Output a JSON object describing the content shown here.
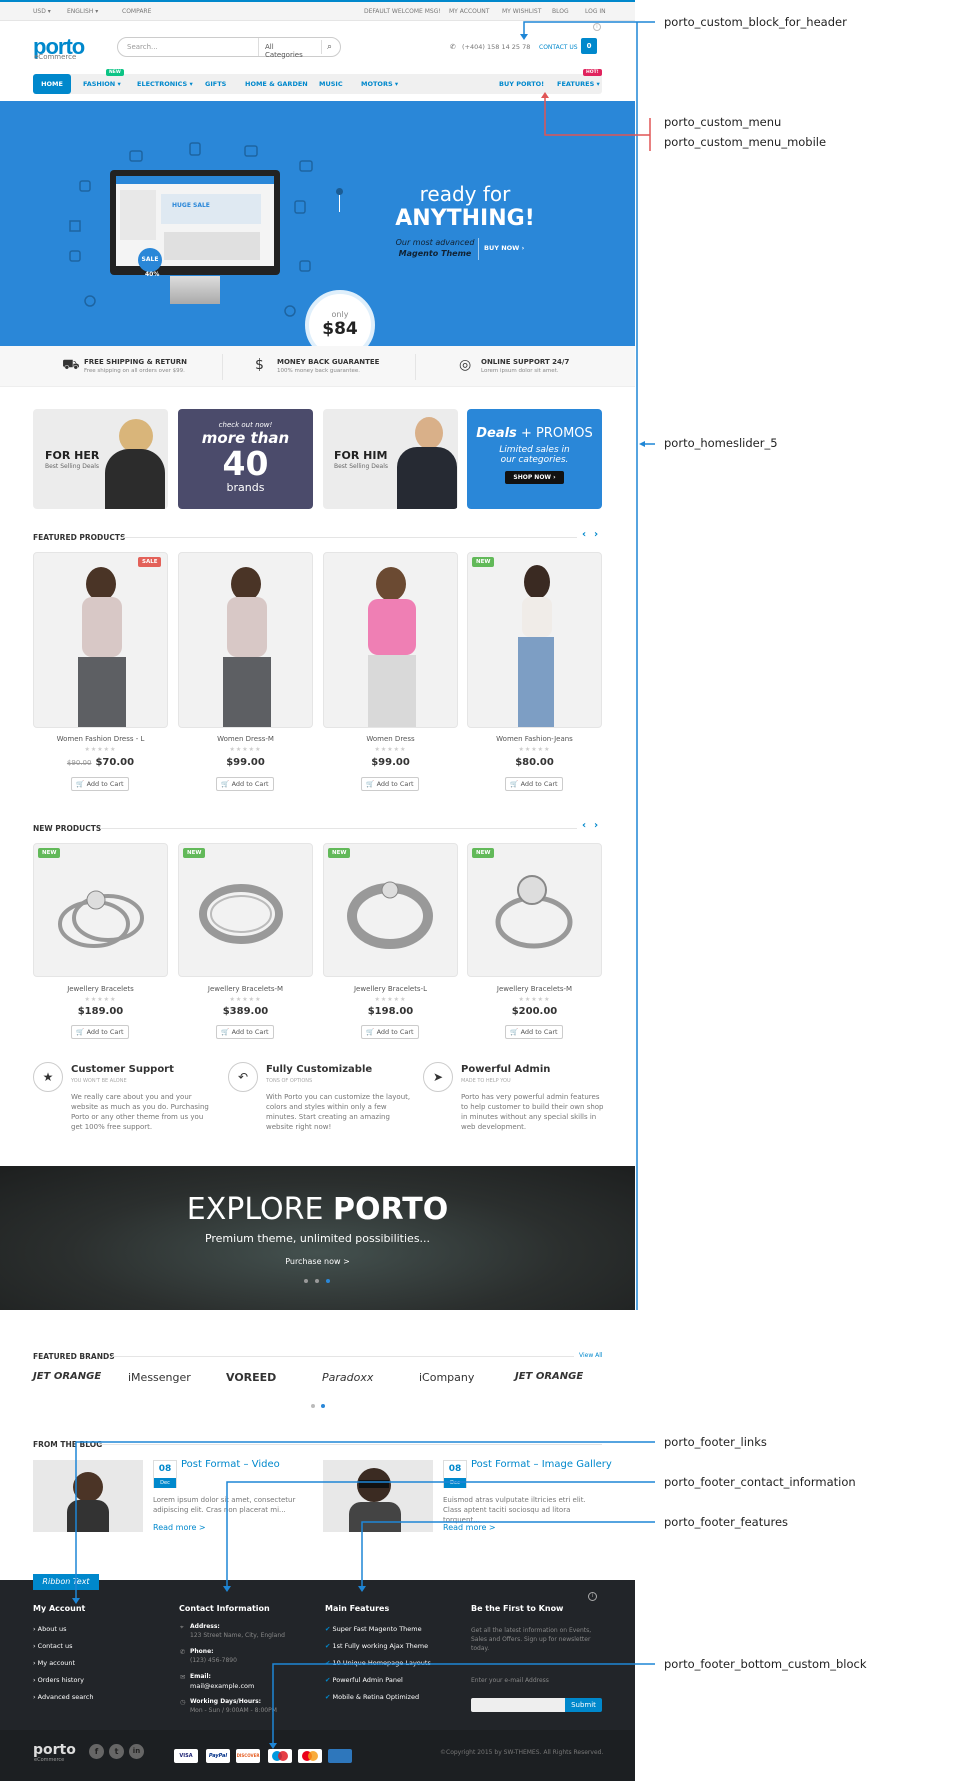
{
  "topbar": {
    "currency": "USD ▾",
    "language": "ENGLISH ▾",
    "compare": "COMPARE",
    "welcome": "DEFAULT WELCOME MSG!",
    "my_account": "MY ACCOUNT",
    "my_wishlist": "MY WISHLIST",
    "blog": "BLOG",
    "login": "LOG IN"
  },
  "header": {
    "logo": "porto",
    "logo_sub": "eCommerce",
    "search_placeholder": "Search...",
    "category": "All Categories",
    "phone": "(+404) 158 14 25 78",
    "contact": "CONTACT US",
    "cart_count": "0"
  },
  "nav": {
    "home": "HOME",
    "fashion": "FASHION ▾",
    "electronics": "ELECTRONICS ▾",
    "gifts": "GIFTS",
    "home_garden": "HOME & GARDEN",
    "music": "MUSIC",
    "motors": "MOTORS ▾",
    "buy": "BUY PORTO!",
    "features": "FEATURES ▾",
    "badge_new": "NEW",
    "badge_hot": "HOT!"
  },
  "hero": {
    "screen_text": "HUGE SALE",
    "sale": "SALE",
    "sale_pct": "40%",
    "only": "only",
    "price": "$84",
    "ready": "ready for",
    "anything": "ANYTHING!",
    "sub1": "Our most advanced",
    "sub2": "Magento Theme",
    "buy": "BUY NOW ›"
  },
  "features": [
    {
      "title": "FREE SHIPPING & RETURN",
      "desc": "Free shipping on all orders over $99.",
      "icon": "truck-icon"
    },
    {
      "title": "MONEY BACK GUARANTEE",
      "desc": "100% money back guarantee.",
      "icon": "dollar-icon"
    },
    {
      "title": "ONLINE SUPPORT 24/7",
      "desc": "Lorem ipsum dolor sit amet.",
      "icon": "lifebuoy-icon"
    }
  ],
  "banners": {
    "her": "FOR HER",
    "her_sub": "Best Selling Deals",
    "check": "check out now!",
    "more": "more than",
    "forty": "40",
    "brands": "brands",
    "him": "FOR HIM",
    "him_sub": "Best Selling Deals",
    "deals": "Deals",
    "promos": "+ PROMOS",
    "limited": "Limited sales in",
    "cats": "our categories.",
    "shop": "SHOP NOW ›"
  },
  "featured": {
    "title": "FEATURED PRODUCTS",
    "items": [
      {
        "name": "Women Fashion Dress - L",
        "old": "$90.00",
        "price": "$70.00",
        "badge": "SALE"
      },
      {
        "name": "Women Dress-M",
        "old": "",
        "price": "$99.00",
        "badge": ""
      },
      {
        "name": "Women Dress",
        "old": "",
        "price": "$99.00",
        "badge": ""
      },
      {
        "name": "Women Fashion-Jeans",
        "old": "",
        "price": "$80.00",
        "badge": "NEW"
      }
    ]
  },
  "newp": {
    "title": "NEW PRODUCTS",
    "items": [
      {
        "name": "Jewellery Bracelets",
        "price": "$189.00",
        "badge": "NEW"
      },
      {
        "name": "Jewellery Bracelets-M",
        "price": "$389.00",
        "badge": "NEW"
      },
      {
        "name": "Jewellery Bracelets-L",
        "price": "$198.00",
        "badge": "NEW"
      },
      {
        "name": "Jewellery Bracelets-M",
        "price": "$200.00",
        "badge": "NEW"
      }
    ]
  },
  "add_to_cart": "Add to Cart",
  "stars": "★★★★★",
  "services": [
    {
      "title": "Customer Support",
      "sub": "YOU WON'T BE ALONE",
      "desc": "We really care about you and your website as much as you do. Purchasing Porto or any other theme from us you get 100% free support.",
      "icon": "star-icon"
    },
    {
      "title": "Fully Customizable",
      "sub": "TONS OF OPTIONS",
      "desc": "With Porto you can customize the layout, colors and styles within only a few minutes. Start creating an amazing website right now!",
      "icon": "undo-icon"
    },
    {
      "title": "Powerful Admin",
      "sub": "MADE TO HELP YOU",
      "desc": "Porto has very powerful admin features to help customer to build their own shop in minutes without any special skills in web development.",
      "icon": "paper-plane-icon"
    }
  ],
  "explore": {
    "t1": "EXPLORE",
    "t2": "PORTO",
    "sub": "Premium theme, unlimited possibilities...",
    "link": "Purchase now >"
  },
  "brands": {
    "title": "FEATURED BRANDS",
    "view": "View All",
    "list": [
      "JET ORANGE",
      "iMessenger",
      "VOREED",
      "Paradoxx",
      "iCompany",
      "JET ORANGE"
    ]
  },
  "blog": {
    "title": "FROM THE BLOG",
    "posts": [
      {
        "day": "08",
        "month": "Dec",
        "title": "Post Format – Video",
        "desc": "Lorem ipsum dolor sit amet, consectetur adipiscing elit. Cras non placerat mi...",
        "more": "Read more >"
      },
      {
        "day": "08",
        "month": "Dec",
        "title": "Post Format – Image Gallery",
        "desc": "Euismod atras vulputate iltricies etri elit. Class aptent taciti sociosqu ad litora torquent...",
        "more": "Read more >"
      }
    ]
  },
  "footer": {
    "ribbon": "Ribbon Text",
    "account_title": "My Account",
    "account_links": [
      "About us",
      "Contact us",
      "My account",
      "Orders history",
      "Advanced search"
    ],
    "contact_title": "Contact Information",
    "address_l": "Address:",
    "address": "123 Street Name, City, England",
    "phone_l": "Phone:",
    "phone": "(123) 456-7890",
    "email_l": "Email:",
    "email": "mail@example.com",
    "hours_l": "Working Days/Hours:",
    "hours": "Mon - Sun / 9:00AM - 8:00PM",
    "features_title": "Main Features",
    "features_list": [
      "Super Fast Magento Theme",
      "1st Fully working Ajax Theme",
      "10 Unique Homepage Layouts",
      "Powerful Admin Panel",
      "Mobile & Retina Optimized"
    ],
    "news_title": "Be the First to Know",
    "news_desc": "Get all the latest information on Events, Sales and Offers. Sign up for newsletter today.",
    "news_label": "Enter your e-mail Address",
    "submit": "Submit",
    "copyright": "©Copyright 2015 by SW-THEMES. All Rights Reserved.",
    "payments": [
      "VISA",
      "PayPal",
      "DISCOVER",
      "",
      "",
      ""
    ]
  },
  "annotations": [
    "porto_custom_block_for_header",
    "porto_custom_menu",
    "porto_custom_menu_mobile",
    "porto_homeslider_5",
    "porto_footer_links",
    "porto_footer_contact_information",
    "porto_footer_features",
    "porto_footer_bottom_custom_block"
  ],
  "colors": {
    "accent": "#0088cc",
    "sale": "#e36159",
    "new": "#62b959",
    "annotation": "#1e86d6",
    "annotation_red": "#e05555"
  }
}
